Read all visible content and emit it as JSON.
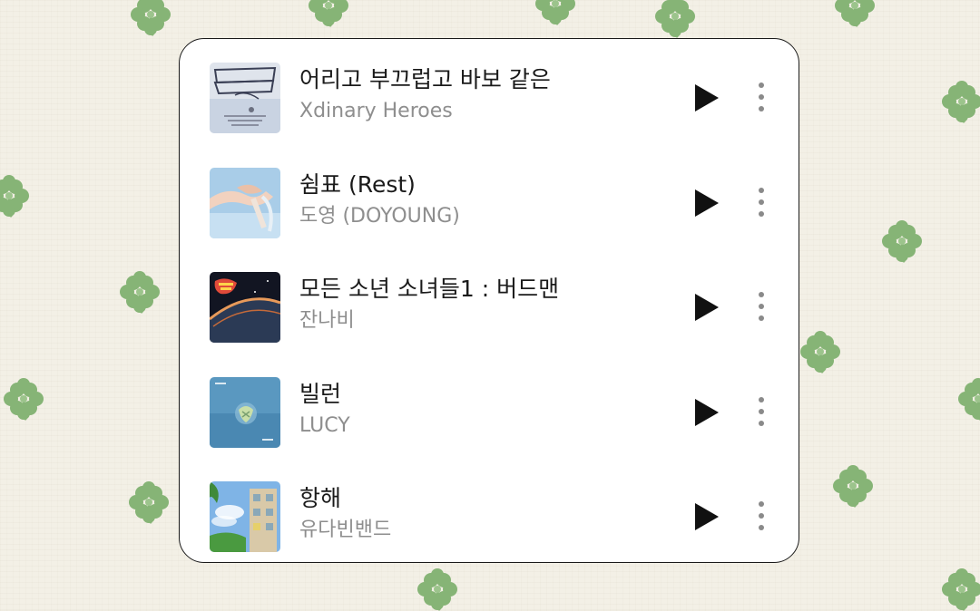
{
  "colors": {
    "background": "#f3f0e6",
    "clover": "#7fae6f",
    "card": "#ffffff",
    "title_text": "#1a1a1a",
    "artist_text": "#8e8e8e",
    "play_icon": "#111111",
    "more_icon": "#8a8a8a"
  },
  "playlist": {
    "items": [
      {
        "title": "어리고 부끄럽고 바보 같은",
        "artist": "Xdinary Heroes",
        "cover_icon": "album-cover-troubleshooting"
      },
      {
        "title": "쉼표 (Rest)",
        "artist": "도영 (DOYOUNG)",
        "cover_icon": "album-cover-hands-sky"
      },
      {
        "title": "모든 소년 소녀들1 : 버드맨",
        "artist": "잔나비",
        "cover_icon": "album-cover-planet"
      },
      {
        "title": "빌런",
        "artist": "LUCY",
        "cover_icon": "album-cover-blue-flower"
      },
      {
        "title": "항해",
        "artist": "유다빈밴드",
        "cover_icon": "album-cover-sky-building"
      }
    ],
    "play_icon": "play-icon",
    "more_icon": "more-vertical-icon"
  }
}
